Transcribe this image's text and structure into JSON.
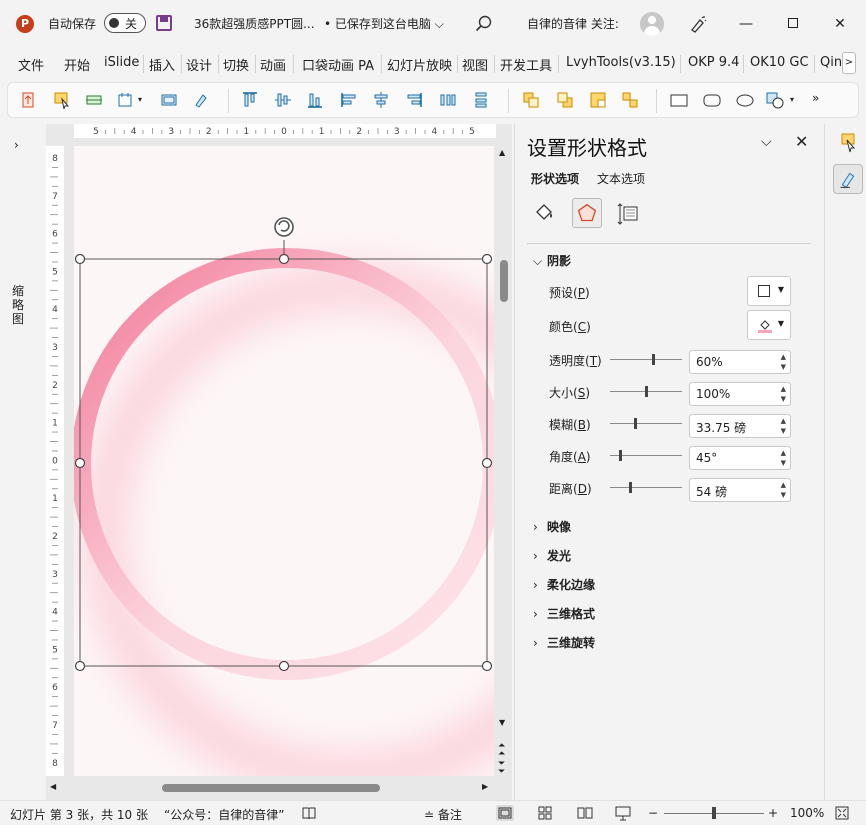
{
  "titlebar": {
    "app_icon_letter": "P",
    "autosave_label": "自动保存",
    "autosave_state": "关",
    "doc_title": "36款超强质感PPT圆...",
    "save_status": "• 已保存到这台电脑",
    "account_name": "自律的音律 关注:"
  },
  "menu": [
    {
      "label": "文件"
    },
    {
      "label": "开始"
    },
    {
      "label": "iSlide"
    },
    {
      "label": "插入"
    },
    {
      "label": "设计"
    },
    {
      "label": "切换"
    },
    {
      "label": "动画"
    },
    {
      "label": "口袋动画 PA"
    },
    {
      "label": "幻灯片放映"
    },
    {
      "label": "视图"
    },
    {
      "label": "开发工具"
    },
    {
      "label": "LvyhTools(v3.15)"
    },
    {
      "label": "OKP 9.4"
    },
    {
      "label": "OK10 GC"
    },
    {
      "label": "Qin"
    }
  ],
  "left_pane": {
    "label": "缩略图"
  },
  "ruler": {
    "h_labels": [
      "5",
      "4",
      "3",
      "2",
      "1",
      "0",
      "1",
      "2",
      "3",
      "4",
      "5"
    ],
    "v_labels": [
      "8",
      "7",
      "6",
      "5",
      "4",
      "3",
      "2",
      "1",
      "0",
      "1",
      "2",
      "3",
      "4",
      "5",
      "6",
      "7",
      "8"
    ]
  },
  "panel": {
    "title": "设置形状格式",
    "tab_shape": "形状选项",
    "tab_text": "文本选项",
    "shadow": {
      "title": "阴影",
      "preset": {
        "label": "预设",
        "key": "P"
      },
      "color": {
        "label": "颜色",
        "key": "C",
        "color": "#f4a7b9"
      },
      "rows": [
        {
          "label": "透明度",
          "key": "T",
          "value": "60%",
          "level": 0.6
        },
        {
          "label": "大小",
          "key": "S",
          "value": "100%",
          "level": 0.5
        },
        {
          "label": "模糊",
          "key": "B",
          "value": "33.75 磅",
          "level": 0.34
        },
        {
          "label": "角度",
          "key": "A",
          "value": "45°",
          "level": 0.125
        },
        {
          "label": "距离",
          "key": "D",
          "value": "54 磅",
          "level": 0.27
        }
      ]
    },
    "sections": [
      {
        "title": "映像"
      },
      {
        "title": "发光"
      },
      {
        "title": "柔化边缘"
      },
      {
        "title": "三维格式"
      },
      {
        "title": "三维旋转"
      }
    ]
  },
  "statusbar": {
    "slide_info": "幻灯片 第 3 张，共 10 张",
    "author": "“公众号：自律的音律”",
    "notes_label": "备注",
    "zoom": "100%",
    "zoom_level": 0.5
  },
  "colors": {
    "ring_pink": "#f07a98",
    "brand_red": "#c43e1c",
    "accent_purple": "#7a3b8f"
  }
}
